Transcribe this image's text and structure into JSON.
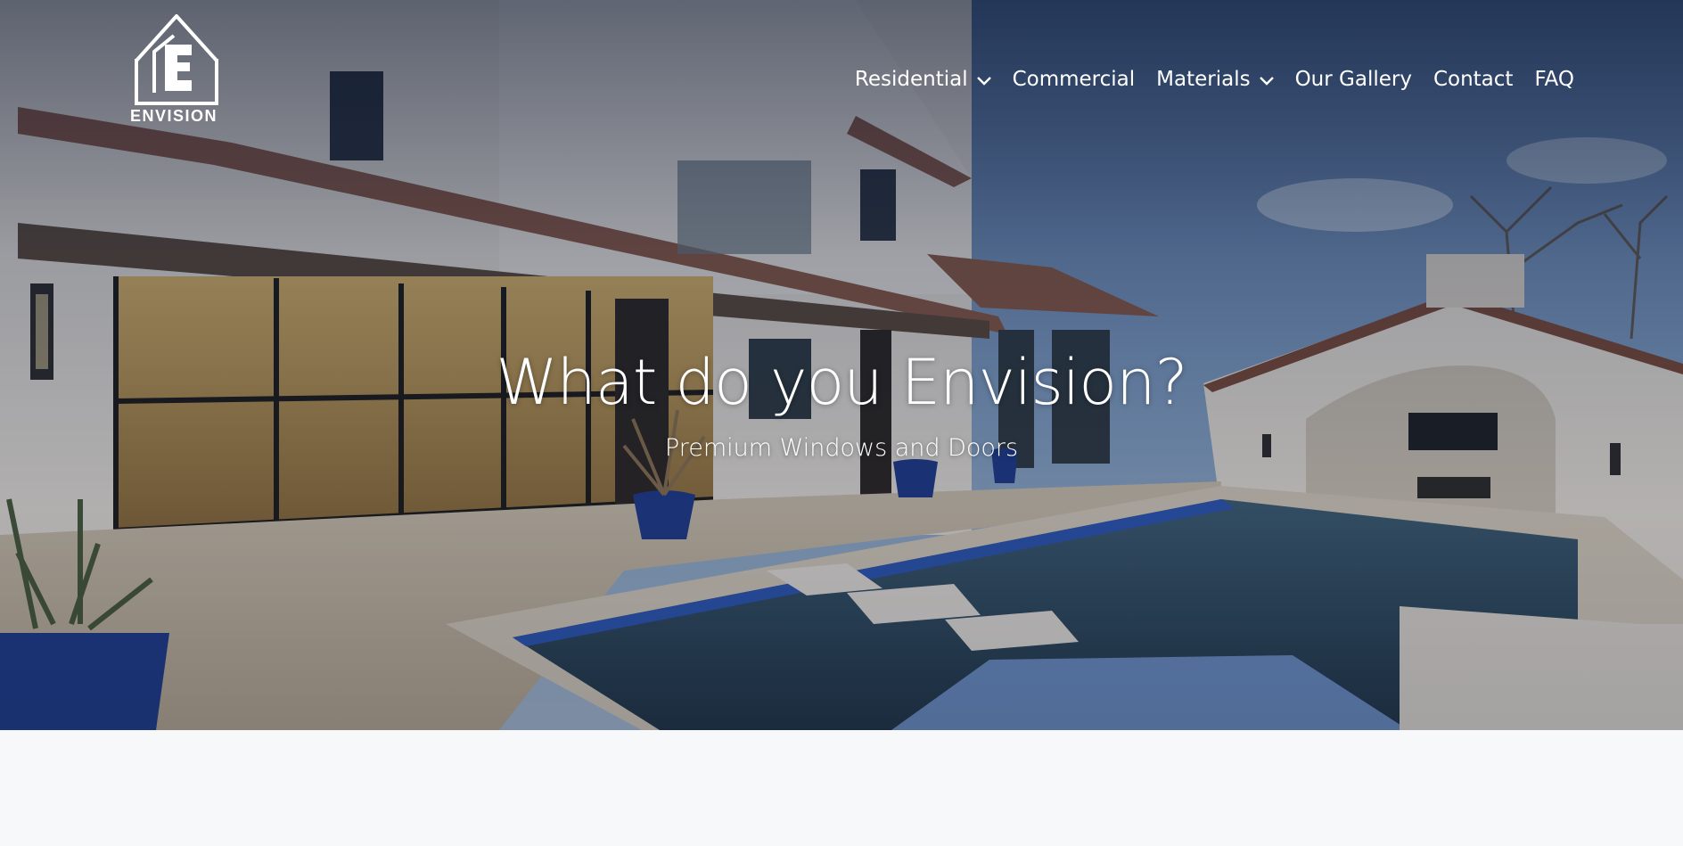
{
  "brand": {
    "logo_text": "ENVISION"
  },
  "nav": {
    "items": [
      {
        "label": "Residential",
        "has_dropdown": true
      },
      {
        "label": "Commercial",
        "has_dropdown": false
      },
      {
        "label": "Materials",
        "has_dropdown": true
      },
      {
        "label": "Our Gallery",
        "has_dropdown": false
      },
      {
        "label": "Contact",
        "has_dropdown": false
      },
      {
        "label": "FAQ",
        "has_dropdown": false
      }
    ]
  },
  "hero": {
    "title": "What do you Envision?",
    "subtitle": "Premium Windows and Doors"
  },
  "colors": {
    "text": "#ffffff",
    "page_bg": "#f7f8fa",
    "overlay": "#0a142d"
  }
}
